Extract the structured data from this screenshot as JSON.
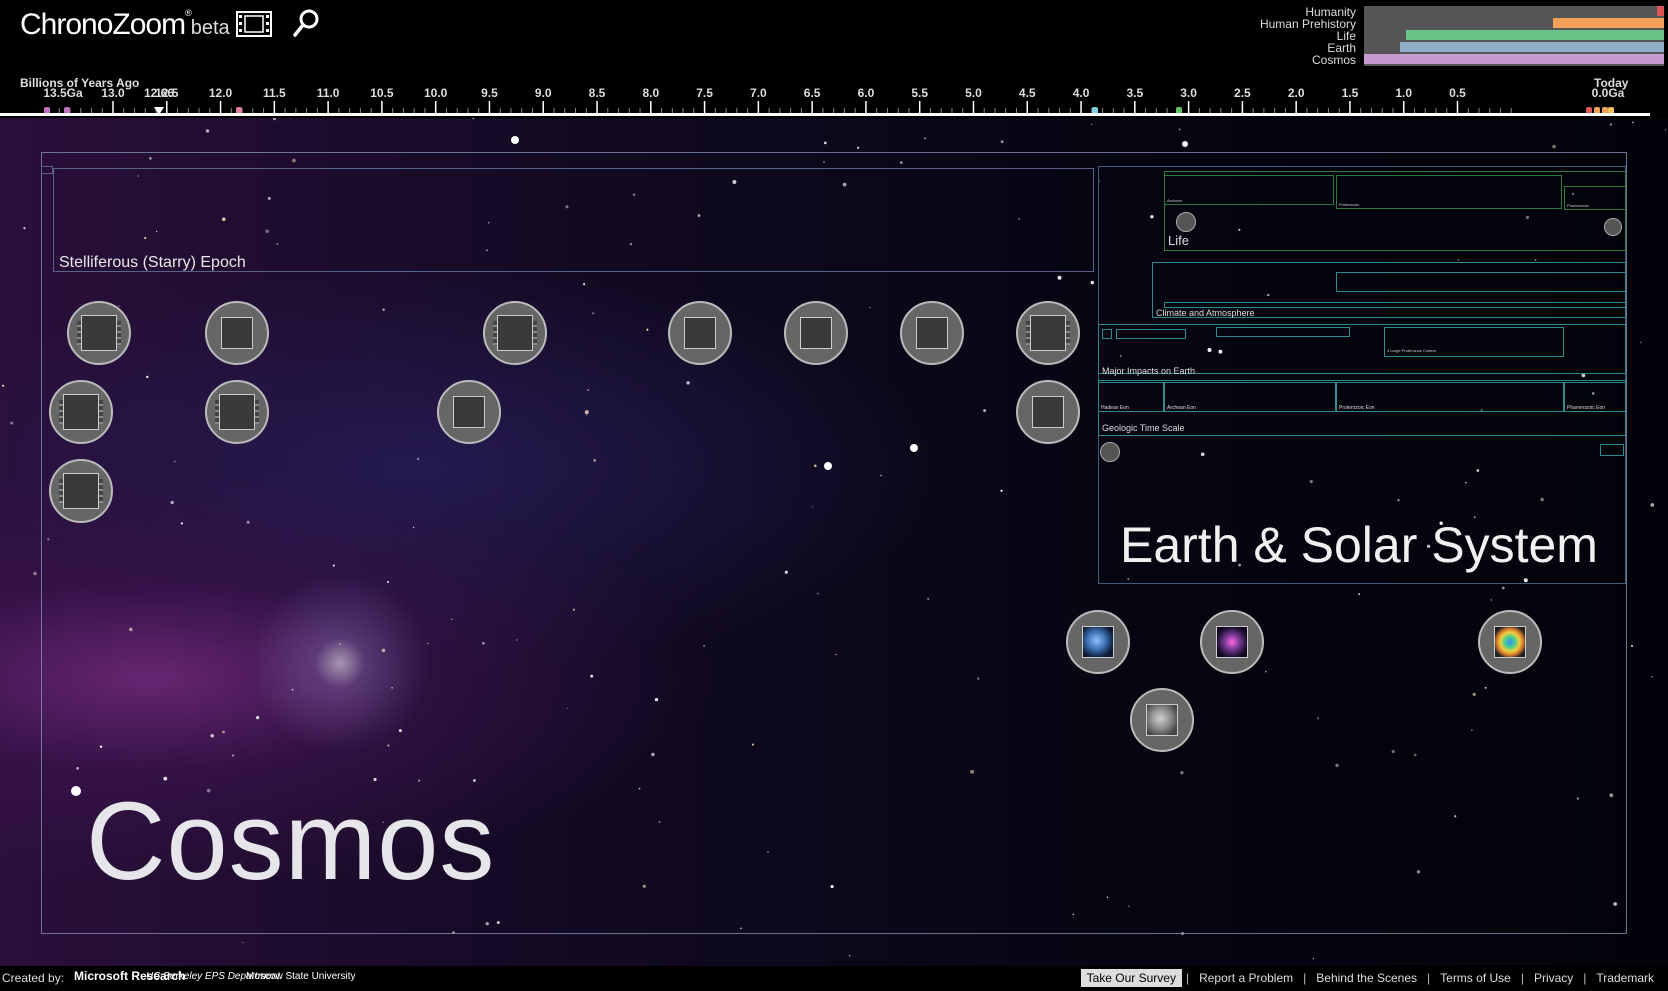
{
  "app": {
    "title": "ChronoZoom",
    "edition": "beta"
  },
  "header": {
    "tour_icon": "film-strip-icon",
    "search_icon": "magnifier-icon"
  },
  "overview": {
    "rows": [
      {
        "label": "Humanity",
        "color": "#e05555",
        "start": 0.975,
        "end": 1.0
      },
      {
        "label": "Human Prehistory",
        "color": "#f2a05a",
        "start": 0.63,
        "end": 1.0
      },
      {
        "label": "Life",
        "color": "#6cc38a",
        "start": 0.14,
        "end": 1.0
      },
      {
        "label": "Earth",
        "color": "#8fb0c8",
        "start": 0.12,
        "end": 1.0
      },
      {
        "label": "Cosmos",
        "color": "#c79bd2",
        "start": 0.0,
        "end": 1.0
      }
    ]
  },
  "ruler": {
    "title": "Billions of Years Ago",
    "today_label": "Today",
    "start_label": "13.5Ga",
    "end_label": "0.0Ga",
    "cursor_label": "12.66",
    "ticks": [
      "13.0",
      "12.5",
      "12.0",
      "11.5",
      "11.0",
      "10.5",
      "10.0",
      "9.5",
      "9.0",
      "8.5",
      "8.0",
      "7.5",
      "7.0",
      "6.5",
      "6.0",
      "5.5",
      "5.0",
      "4.5",
      "4.0",
      "3.5",
      "3.0",
      "2.5",
      "2.0",
      "1.5",
      "1.0",
      "0.5"
    ]
  },
  "canvas": {
    "cosmos": {
      "title": "Cosmos"
    },
    "stelliferous": {
      "title": "Stelliferous (Starry) Epoch"
    },
    "earth": {
      "title": "Earth & Solar System",
      "life": {
        "title": "Life",
        "sub": [
          "Archean",
          "Proterozoic",
          "Phanerozoic"
        ]
      },
      "climate": {
        "title": "Climate and Atmosphere"
      },
      "impacts": {
        "title": "Major Impacts on Earth",
        "note": "3 Large Proterozoic Craters"
      },
      "geologic": {
        "title": "Geologic Time Scale",
        "eons": [
          "Hadean Eon",
          "Archean Eon",
          "Proterozoic Eon",
          "Phanerozoic Eon"
        ]
      }
    },
    "items": [
      {
        "name": "content-item",
        "kind": "film"
      },
      {
        "name": "content-item",
        "kind": "plain"
      },
      {
        "name": "content-item",
        "kind": "film"
      },
      {
        "name": "content-item",
        "kind": "plain"
      },
      {
        "name": "content-item",
        "kind": "plain"
      },
      {
        "name": "content-item",
        "kind": "plain"
      },
      {
        "name": "content-item",
        "kind": "film"
      },
      {
        "name": "content-item",
        "kind": "film"
      },
      {
        "name": "content-item",
        "kind": "film"
      },
      {
        "name": "content-item",
        "kind": "plain"
      },
      {
        "name": "content-item",
        "kind": "plain"
      },
      {
        "name": "content-item",
        "kind": "film"
      }
    ],
    "media_items": [
      {
        "name": "earth-photo-item",
        "color": "#3b6fb0"
      },
      {
        "name": "galaxy-photo-item",
        "color": "#7a3a9a"
      },
      {
        "name": "cmb-map-item",
        "color": "#d67a2a"
      },
      {
        "name": "asteroid-photo-item",
        "color": "#8a8a8a"
      }
    ]
  },
  "footer": {
    "created_by": "Created by:",
    "sponsors": [
      "Microsoft Research",
      "UC Berkeley EPS Department",
      "Moscow State University"
    ],
    "links": [
      "Take Our Survey",
      "Report a Problem",
      "Behind the Scenes",
      "Terms of Use",
      "Privacy",
      "Trademark"
    ]
  }
}
